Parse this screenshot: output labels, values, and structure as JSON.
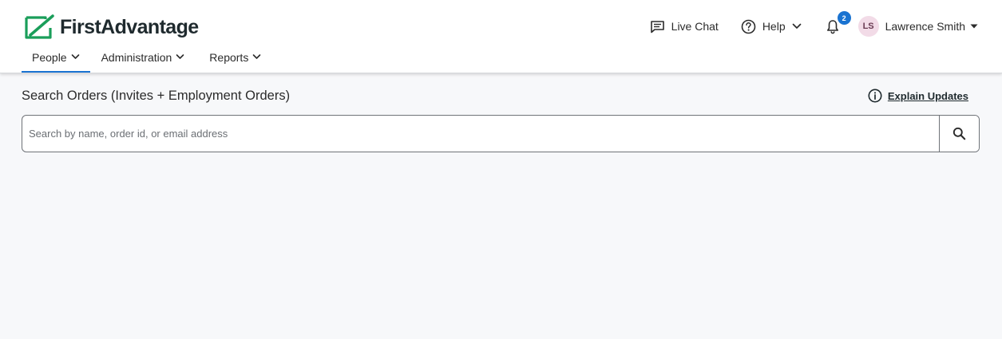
{
  "brand": {
    "name": "FirstAdvantage",
    "accent_color": "#1a9e5a"
  },
  "header": {
    "live_chat": {
      "label": "Live Chat",
      "icon": "chat-icon"
    },
    "help": {
      "label": "Help",
      "icon": "help-icon"
    },
    "notifications": {
      "count": "2",
      "icon": "bell-icon",
      "badge_color": "#1a73d1"
    },
    "user": {
      "initials": "LS",
      "name": "Lawrence Smith"
    }
  },
  "nav": {
    "tabs": [
      {
        "label": "People",
        "active": true
      },
      {
        "label": "Administration",
        "active": false
      },
      {
        "label": "Reports",
        "active": false
      }
    ]
  },
  "main": {
    "title": "Search Orders (Invites + Employment Orders)",
    "explain_updates": "Explain Updates",
    "search": {
      "placeholder": "Search by name, order id, or email address",
      "value": ""
    }
  }
}
